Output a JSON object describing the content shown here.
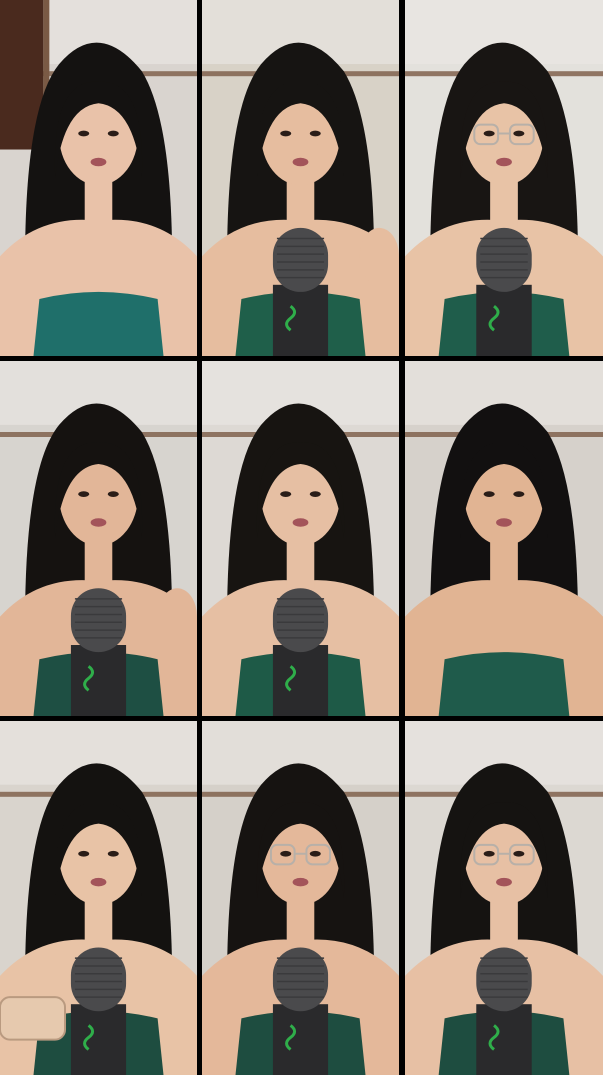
{
  "collage": {
    "tiles": [
      {
        "frame": "frame-1",
        "wall": "#d9d4cf",
        "skin": "#e9c2a9",
        "hair": "#141211",
        "top": "#1f6f6a",
        "glasses": false,
        "mic": false,
        "door": true,
        "object": "none"
      },
      {
        "frame": "frame-2",
        "wall": "#d8d2c7",
        "skin": "#e6bd9f",
        "hair": "#161412",
        "top": "#1f5f4a",
        "glasses": false,
        "mic": true,
        "door": false,
        "object": "hand"
      },
      {
        "frame": "frame-3",
        "wall": "#e3e1dc",
        "skin": "#e8c3a6",
        "hair": "#181513",
        "top": "#1f5d4b",
        "glasses": true,
        "mic": true,
        "door": false,
        "object": "none"
      },
      {
        "frame": "frame-4",
        "wall": "#d7d4cf",
        "skin": "#e2b698",
        "hair": "#151210",
        "top": "#1e4f43",
        "glasses": false,
        "mic": true,
        "door": false,
        "object": "hand"
      },
      {
        "frame": "frame-5",
        "wall": "#ddd9d4",
        "skin": "#e6bfa3",
        "hair": "#171411",
        "top": "#1e5a47",
        "glasses": false,
        "mic": true,
        "door": false,
        "object": "none"
      },
      {
        "frame": "frame-6",
        "wall": "#d6d1cb",
        "skin": "#e1b493",
        "hair": "#121010",
        "top": "#1f5b4b",
        "glasses": false,
        "mic": false,
        "door": false,
        "object": "none"
      },
      {
        "frame": "frame-7",
        "wall": "#d9d4cd",
        "skin": "#e8c3a6",
        "hair": "#141210",
        "top": "#1e4d40",
        "glasses": false,
        "mic": true,
        "door": false,
        "object": "box"
      },
      {
        "frame": "frame-8",
        "wall": "#d5d0c9",
        "skin": "#e4b89a",
        "hair": "#161311",
        "top": "#1e4d40",
        "glasses": true,
        "mic": true,
        "door": false,
        "object": "none"
      },
      {
        "frame": "frame-9",
        "wall": "#dcd8d2",
        "skin": "#e7c0a4",
        "hair": "#151311",
        "top": "#1e4d40",
        "glasses": true,
        "mic": true,
        "door": false,
        "object": "none"
      }
    ],
    "colors": {
      "mic_head": "#4a4a4c",
      "mic_body": "#2a2a2c",
      "mic_logo": "#2fae4a",
      "trim": "#7a5a45",
      "chair": "#e0607a"
    }
  }
}
